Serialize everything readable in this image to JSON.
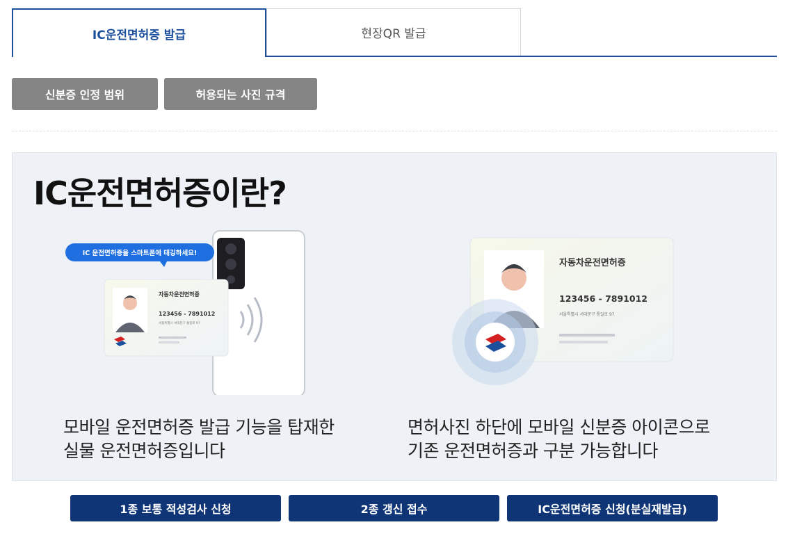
{
  "tabs": [
    {
      "label": "IC운전면허증 발급",
      "active": true
    },
    {
      "label": "현장QR 발급",
      "active": false
    }
  ],
  "info_buttons": {
    "id_scope": "신분증 인정 범위",
    "photo_rules": "허용되는 사진 규격"
  },
  "panel": {
    "title": "IC운전면허증이란?",
    "illustration1": {
      "bubble": "IC 운전면허증을 스마트폰에 태깅하세요!",
      "card_title": "자동차운전면허증",
      "card_number": "123456 - 7891012",
      "card_address": "서울특별시 서대문구 통일로 97"
    },
    "illustration2": {
      "card_title": "자동차운전면허증",
      "card_number": "123456 - 7891012",
      "card_address": "서울특별시 서대문구 통일로 97"
    },
    "desc1_line1": "모바일 운전면허증 발급 기능을 탑재한",
    "desc1_line2": "실물 운전면허증입니다",
    "desc2_line1": "면허사진 하단에 모바일 신분증 아이콘으로",
    "desc2_line2": "기존 운전면허증과 구분 가능합니다"
  },
  "actions": {
    "aptitude_test": "1종 보통 적성검사 신청",
    "renewal": "2종 갱신 접수",
    "ic_apply": "IC운전면허증 신청(분실재발급)"
  },
  "colors": {
    "accent": "#1c4f9c",
    "navy": "#0f3576",
    "gray_button": "#858585",
    "panel_bg": "#eef1f6"
  }
}
